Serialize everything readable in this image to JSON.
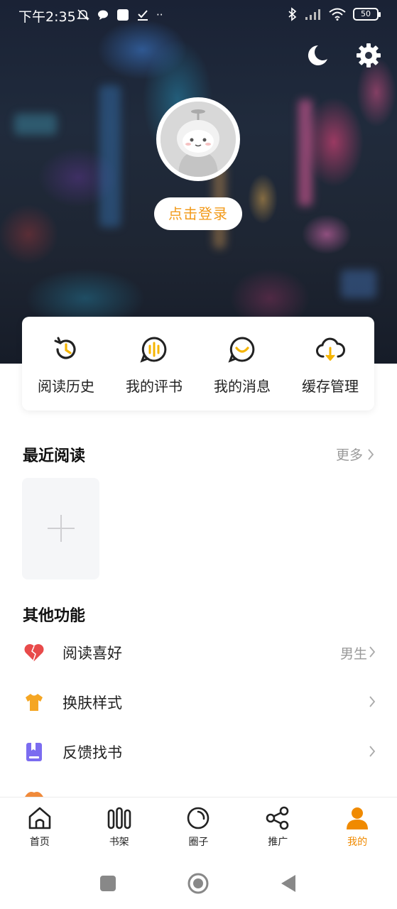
{
  "status_bar": {
    "time": "下午2:35",
    "battery": "50"
  },
  "profile": {
    "login_label": "点击登录"
  },
  "quick_actions": [
    {
      "label": "阅读历史",
      "icon": "history-icon"
    },
    {
      "label": "我的评书",
      "icon": "audio-review-icon"
    },
    {
      "label": "我的消息",
      "icon": "message-icon"
    },
    {
      "label": "缓存管理",
      "icon": "cloud-download-icon"
    }
  ],
  "recent": {
    "title": "最近阅读",
    "more_label": "更多"
  },
  "other": {
    "title": "其他功能",
    "items": [
      {
        "label": "阅读喜好",
        "value": "男生",
        "icon": "heart-icon"
      },
      {
        "label": "换肤样式",
        "value": "",
        "icon": "shirt-icon"
      },
      {
        "label": "反馈找书",
        "value": "",
        "icon": "book-icon"
      }
    ]
  },
  "bottom_nav": [
    {
      "label": "首页",
      "icon": "home-icon"
    },
    {
      "label": "书架",
      "icon": "bookshelf-icon"
    },
    {
      "label": "圈子",
      "icon": "circle-icon"
    },
    {
      "label": "推广",
      "icon": "share-icon"
    },
    {
      "label": "我的",
      "icon": "user-icon",
      "active": true
    }
  ],
  "colors": {
    "accent": "#f29a1a",
    "active_nav": "#f08a00",
    "heart": "#e84a4a",
    "shirt": "#f5a623",
    "book": "#7b6cf0"
  }
}
